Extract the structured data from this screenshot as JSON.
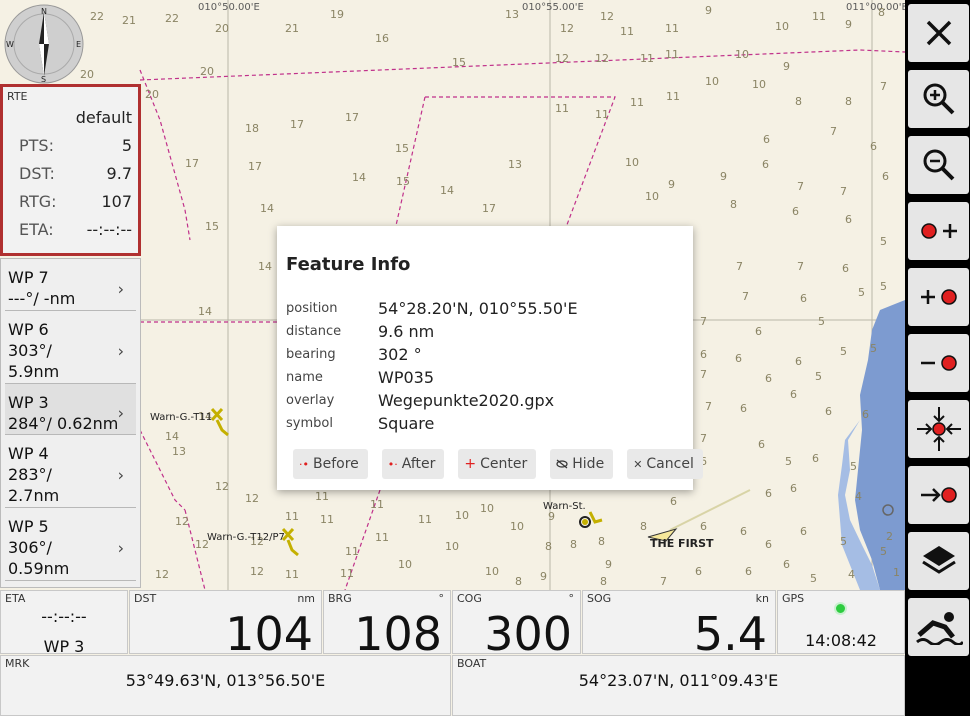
{
  "chart": {
    "longitude_labels": [
      "010°50.00'E",
      "010°55.00'E",
      "011°00.00'E"
    ],
    "marks": {
      "warn_t11": "Warn-G.-T11",
      "warn_t12": "Warn-G.-T12/P7",
      "warn_st": "Warn-St.",
      "boat": "THE FIRST"
    },
    "compass_letters": {
      "n": "N",
      "s": "S",
      "e": "E",
      "w": "W"
    }
  },
  "route_panel": {
    "title": "RTE",
    "name": "default",
    "rows": [
      {
        "key": "PTS:",
        "value": "5"
      },
      {
        "key": "DST:",
        "value": "9.7"
      },
      {
        "key": "RTG:",
        "value": "107"
      },
      {
        "key": "ETA:",
        "value": "--:--:--"
      }
    ]
  },
  "waypoints": [
    {
      "name": "WP 7",
      "line1": "---°/ -nm",
      "line2": ""
    },
    {
      "name": "WP 6",
      "line1": "303°/",
      "line2": "5.9nm"
    },
    {
      "name": "WP 3",
      "line1": "284°/ 0.62nm",
      "line2": ""
    },
    {
      "name": "WP 4",
      "line1": "283°/",
      "line2": "2.7nm"
    },
    {
      "name": "WP 5",
      "line1": "306°/",
      "line2": "0.59nm"
    }
  ],
  "instruments": {
    "eta": {
      "label": "ETA",
      "value": "--:--:--",
      "wp": "WP 3"
    },
    "dst": {
      "label": "DST",
      "unit": "nm",
      "value": "104"
    },
    "brg": {
      "label": "BRG",
      "unit": "°",
      "value": "108"
    },
    "cog": {
      "label": "COG",
      "unit": "°",
      "value": "300"
    },
    "sog": {
      "label": "SOG",
      "unit": "kn",
      "value": "5.4"
    },
    "gps": {
      "label": "GPS",
      "time": "14:08:42"
    },
    "mrk": {
      "label": "MRK",
      "value": "53°49.63'N, 013°56.50'E"
    },
    "boat": {
      "label": "BOAT",
      "value": "54°23.07'N, 011°09.43'E"
    }
  },
  "dialog": {
    "title": "Feature Info",
    "fields": [
      {
        "key": "position",
        "value": "54°28.20'N, 010°55.50'E"
      },
      {
        "key": "distance",
        "value": "9.6 nm"
      },
      {
        "key": "bearing",
        "value": "302 °"
      },
      {
        "key": "name",
        "value": "WP035"
      },
      {
        "key": "overlay",
        "value": "Wegepunkte2020.gpx"
      },
      {
        "key": "symbol",
        "value": "Square"
      }
    ],
    "buttons": {
      "before": "Before",
      "after": "After",
      "center": "Center",
      "hide": "Hide",
      "cancel": "Cancel"
    }
  },
  "toolbar": {
    "icons": [
      "close-icon",
      "zoom-in-icon",
      "zoom-out-icon",
      "marker-add-icon",
      "add-marker-icon",
      "remove-marker-icon",
      "center-marker-icon",
      "goto-marker-icon",
      "layers-icon",
      "anchor-watch-icon"
    ]
  },
  "colors": {
    "route": "#c0308a",
    "route_panel_border": "#b03030",
    "water_deep": "#f5f1e4",
    "water_shallow": "#6f8fc8",
    "gps_ok": "#2ecc40",
    "marker_red": "#e02020"
  }
}
